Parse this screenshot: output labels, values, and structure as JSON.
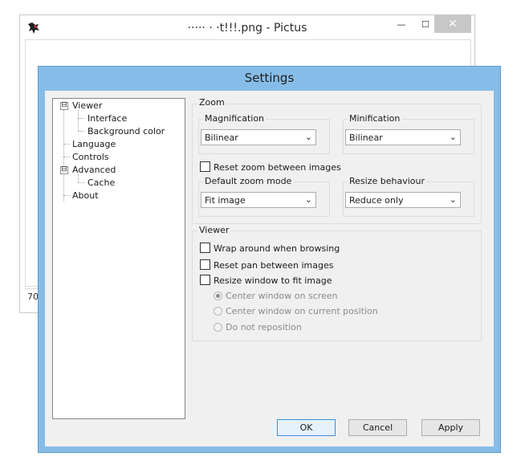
{
  "main_window": {
    "title": "·····  ·  ·t!!!.png - Pictus",
    "status": "70'",
    "controls": {
      "minimize": "—",
      "maximize": "☐",
      "close": "✕"
    }
  },
  "settings": {
    "title": "Settings",
    "tree": [
      {
        "label": "Viewer",
        "expander": "⊟"
      },
      {
        "label": "Interface"
      },
      {
        "label": "Background color"
      },
      {
        "label": "Language"
      },
      {
        "label": "Controls"
      },
      {
        "label": "Advanced",
        "expander": "⊟"
      },
      {
        "label": "Cache"
      },
      {
        "label": "About"
      }
    ],
    "zoom": {
      "group_label": "Zoom",
      "magnification": {
        "label": "Magnification",
        "value": "Bilinear"
      },
      "minification": {
        "label": "Minification",
        "value": "Bilinear"
      },
      "reset_zoom": {
        "label": "Reset zoom between images",
        "checked": false
      },
      "default_zoom_mode": {
        "label": "Default zoom mode",
        "value": "Fit image"
      },
      "resize_behaviour": {
        "label": "Resize behaviour",
        "value": "Reduce only"
      }
    },
    "viewer": {
      "group_label": "Viewer",
      "wrap_around": {
        "label": "Wrap around when browsing",
        "checked": false
      },
      "reset_pan": {
        "label": "Reset pan between images",
        "checked": false
      },
      "resize_window": {
        "label": "Resize window to fit image",
        "checked": false
      },
      "radios": [
        {
          "label": "Center window on screen",
          "selected": true
        },
        {
          "label": "Center window on current position",
          "selected": false
        },
        {
          "label": "Do not reposition",
          "selected": false
        }
      ]
    },
    "buttons": {
      "ok": "OK",
      "cancel": "Cancel",
      "apply": "Apply"
    },
    "dropdown_arrow": "⌄"
  }
}
